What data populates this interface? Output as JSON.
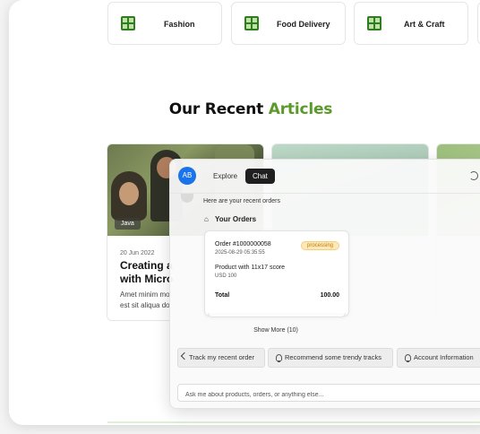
{
  "categories": [
    {
      "label": "Fashion",
      "icon": "grid-icon"
    },
    {
      "label": "Food Delivery",
      "icon": "grid-icon"
    },
    {
      "label": "Art & Craft",
      "icon": "grid-icon"
    }
  ],
  "section": {
    "heading_part1": "Our Recent ",
    "heading_part2": "Articles",
    "accent_color": "#5a9a2b"
  },
  "article": {
    "tag": "Java",
    "date": "20 Jun 2022",
    "title": "Creating a\nwith Micro",
    "excerpt": "Amet minim mol\nest sit aliqua do"
  },
  "chat": {
    "avatar": "AB",
    "tabs": [
      "Explore",
      "Chat"
    ],
    "active_tab": "Chat",
    "intro": "Here are your recent orders",
    "orders_title": "Your Orders",
    "order": {
      "number": "Order #1000000058",
      "datetime": "2025-08-29 05:35:55",
      "status": "processing",
      "product": "Product with 11x17 score",
      "price": "USD 100",
      "total_label": "Total",
      "total_value": "100.00"
    },
    "show_more": "Show More (10)",
    "suggestions": [
      "Track my recent order",
      "Recommend some trendy tracks",
      "Account Information"
    ],
    "input_placeholder": "Ask me about products, orders, or anything else..."
  }
}
